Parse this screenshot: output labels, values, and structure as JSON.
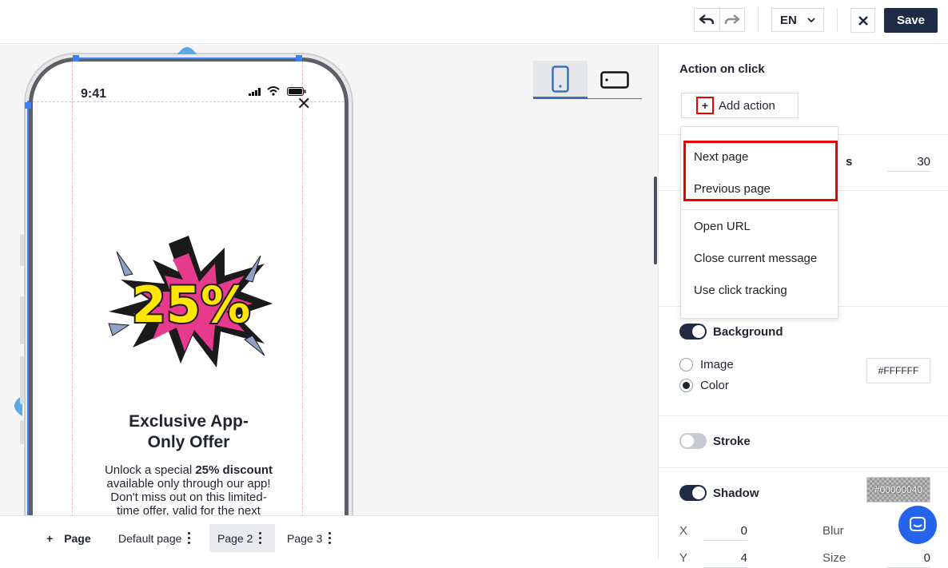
{
  "toolbar": {
    "language": "EN",
    "save_label": "Save"
  },
  "phone": {
    "time": "9:41",
    "offer_badge": "25%",
    "headline_line1": "Exclusive App-",
    "headline_line2": "Only Offer",
    "body_prefix": "Unlock a special ",
    "body_bold": "25% discount",
    "body_rest1": "available only through our app!",
    "body_rest2": "Don't miss out on this limited-",
    "body_rest3": "time offer, valid for the next"
  },
  "pages": {
    "add_label": "Page",
    "tabs": [
      "Default page",
      "Page 2",
      "Page 3"
    ],
    "active_index": 1
  },
  "panel": {
    "action_title": "Action on click",
    "add_action_label": "Add action",
    "partial_label": "s",
    "value_30": "30",
    "background_label": "Background",
    "image_label": "Image",
    "color_label": "Color",
    "background_color": "#FFFFFF",
    "stroke_label": "Stroke",
    "shadow_label": "Shadow",
    "shadow_color": "#00000040",
    "x_label": "X",
    "x_value": "0",
    "y_label": "Y",
    "y_value": "4",
    "blur_label": "Blur",
    "size_label": "Size",
    "size_value": "0"
  },
  "dropdown": {
    "items": [
      "Next page",
      "Previous page",
      "Open URL",
      "Close current message",
      "Use click tracking"
    ]
  },
  "colors": {
    "accent": "#1f2a44",
    "highlight": "#e00000",
    "selection": "#3b82f6",
    "chat": "#2563eb"
  }
}
